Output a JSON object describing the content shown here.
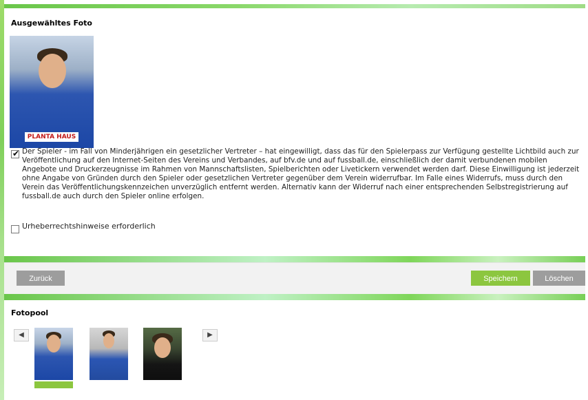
{
  "selected_photo": {
    "title": "Ausgewähltes Foto"
  },
  "consent": {
    "checked": true,
    "text": "Der Spieler - im Fall von Minderjährigen ein gesetzlicher Vertreter – hat eingewilligt, dass das für den Spielerpass zur Verfügung gestellte Lichtbild auch zur Veröffentlichung auf den Internet-Seiten des Vereins und Verbandes, auf bfv.de und auf fussball.de, einschließlich der damit verbundenen mobilen Angebote und Druckerzeugnisse im Rahmen von Mannschaftslisten, Spielberichten oder Livetickern verwendet werden darf. Diese Einwilligung ist jederzeit ohne Angabe von Gründen durch den Spieler oder gesetzlichen Vertreter gegenüber dem Verein widerrufbar. Im Falle eines Widerrufs, muss durch den Verein das Veröffentlichungskennzeichen unverzüglich entfernt werden. Alternativ kann der Widerruf nach einer entsprechenden Selbstregistrierung auf fussball.de auch durch den Spieler online erfolgen."
  },
  "copyright": {
    "checked": false,
    "label": "Urheberrechtshinweise erforderlich"
  },
  "toolbar": {
    "back_label": "Zurück",
    "save_label": "Speichern",
    "delete_label": "Löschen"
  },
  "fotopool": {
    "title": "Fotopool",
    "prev_icon": "◀",
    "next_icon": "▶",
    "selected_index": 0,
    "thumbnails": [
      "player-photo-1",
      "player-photo-2",
      "player-photo-3"
    ]
  },
  "colors": {
    "accent_green": "#8cc63f",
    "button_gray": "#9d9d9d"
  }
}
